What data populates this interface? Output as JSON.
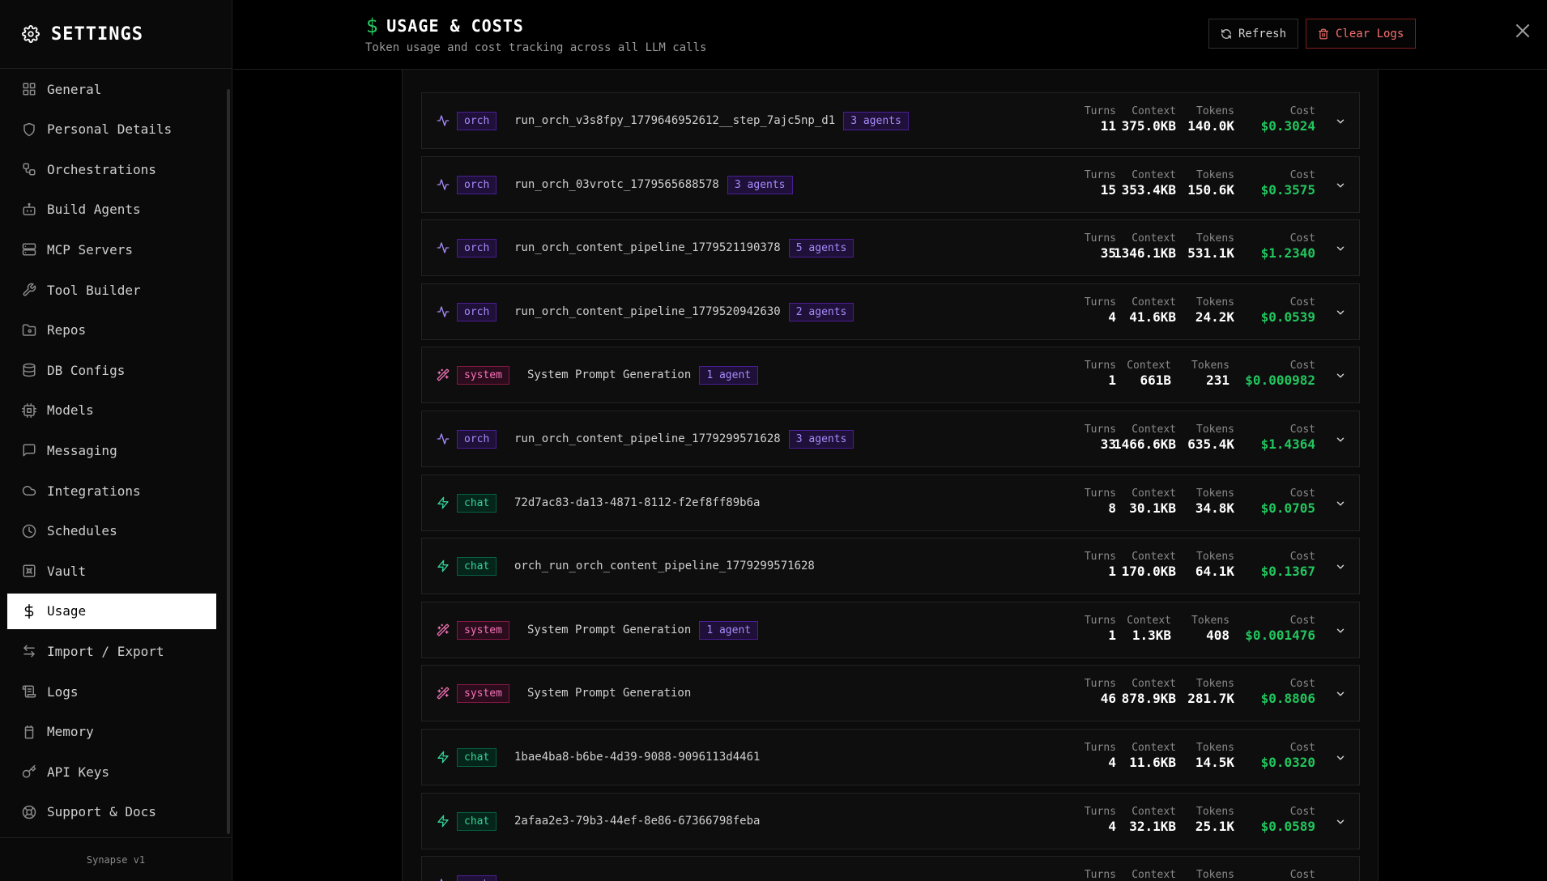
{
  "sidebar": {
    "title": "SETTINGS",
    "footer": "Synapse v1",
    "items": [
      {
        "label": "General",
        "icon": "grid-icon"
      },
      {
        "label": "Personal Details",
        "icon": "shield-icon"
      },
      {
        "label": "Orchestrations",
        "icon": "workflow-icon"
      },
      {
        "label": "Build Agents",
        "icon": "bot-icon"
      },
      {
        "label": "MCP Servers",
        "icon": "server-icon"
      },
      {
        "label": "Tool Builder",
        "icon": "wrench-icon"
      },
      {
        "label": "Repos",
        "icon": "folder-git-icon"
      },
      {
        "label": "DB Configs",
        "icon": "database-icon"
      },
      {
        "label": "Models",
        "icon": "cpu-icon"
      },
      {
        "label": "Messaging",
        "icon": "message-icon"
      },
      {
        "label": "Integrations",
        "icon": "cloud-icon"
      },
      {
        "label": "Schedules",
        "icon": "clock-icon"
      },
      {
        "label": "Vault",
        "icon": "vault-icon"
      },
      {
        "label": "Usage",
        "icon": "dollar-icon",
        "active": true
      },
      {
        "label": "Import / Export",
        "icon": "arrows-icon"
      },
      {
        "label": "Logs",
        "icon": "scroll-icon"
      },
      {
        "label": "Memory",
        "icon": "memory-icon"
      },
      {
        "label": "API Keys",
        "icon": "key-icon"
      },
      {
        "label": "Support & Docs",
        "icon": "lifebuoy-icon"
      }
    ]
  },
  "header": {
    "title": "USAGE & COSTS",
    "subtitle": "Token usage and cost tracking across all LLM calls",
    "refresh_label": "Refresh",
    "clear_label": "Clear Logs"
  },
  "stat_labels": {
    "turns": "Turns",
    "context": "Context",
    "tokens": "Tokens",
    "cost": "Cost"
  },
  "colors": {
    "accent": "#22c55e",
    "orch": "#a78bfa",
    "system": "#f472b6",
    "chat": "#34d399",
    "danger": "#f87171"
  },
  "rows": [
    {
      "type": "orch",
      "name": "run_orch_v3s8fpy_1779646952612__step_7ajc5np_d1",
      "agents": "3 agents",
      "turns": "11",
      "context": "375.0KB",
      "tokens": "140.0K",
      "cost": "$0.3024"
    },
    {
      "type": "orch",
      "name": "run_orch_03vrotc_1779565688578",
      "agents": "3 agents",
      "turns": "15",
      "context": "353.4KB",
      "tokens": "150.6K",
      "cost": "$0.3575"
    },
    {
      "type": "orch",
      "name": "run_orch_content_pipeline_1779521190378",
      "agents": "5 agents",
      "turns": "35",
      "context": "1346.1KB",
      "tokens": "531.1K",
      "cost": "$1.2340"
    },
    {
      "type": "orch",
      "name": "run_orch_content_pipeline_1779520942630",
      "agents": "2 agents",
      "turns": "4",
      "context": "41.6KB",
      "tokens": "24.2K",
      "cost": "$0.0539"
    },
    {
      "type": "system",
      "name": "System Prompt Generation",
      "agents": "1 agent",
      "turns": "1",
      "context": "661B",
      "tokens": "231",
      "cost": "$0.000982"
    },
    {
      "type": "orch",
      "name": "run_orch_content_pipeline_1779299571628",
      "agents": "3 agents",
      "turns": "33",
      "context": "1466.6KB",
      "tokens": "635.4K",
      "cost": "$1.4364"
    },
    {
      "type": "chat",
      "name": "72d7ac83-da13-4871-8112-f2ef8ff89b6a",
      "agents": "",
      "turns": "8",
      "context": "30.1KB",
      "tokens": "34.8K",
      "cost": "$0.0705"
    },
    {
      "type": "chat",
      "name": "orch_run_orch_content_pipeline_1779299571628",
      "agents": "",
      "turns": "1",
      "context": "170.0KB",
      "tokens": "64.1K",
      "cost": "$0.1367"
    },
    {
      "type": "system",
      "name": "System Prompt Generation",
      "agents": "1 agent",
      "turns": "1",
      "context": "1.3KB",
      "tokens": "408",
      "cost": "$0.001476"
    },
    {
      "type": "system",
      "name": "System Prompt Generation",
      "agents": "",
      "turns": "46",
      "context": "878.9KB",
      "tokens": "281.7K",
      "cost": "$0.8806"
    },
    {
      "type": "chat",
      "name": "1bae4ba8-b6be-4d39-9088-9096113d4461",
      "agents": "",
      "turns": "4",
      "context": "11.6KB",
      "tokens": "14.5K",
      "cost": "$0.0320"
    },
    {
      "type": "chat",
      "name": "2afaa2e3-79b3-44ef-8e86-67366798feba",
      "agents": "",
      "turns": "4",
      "context": "32.1KB",
      "tokens": "25.1K",
      "cost": "$0.0589"
    },
    {
      "type": "orch",
      "name": "",
      "agents": "",
      "turns": "",
      "context": "",
      "tokens": "",
      "cost": ""
    }
  ]
}
